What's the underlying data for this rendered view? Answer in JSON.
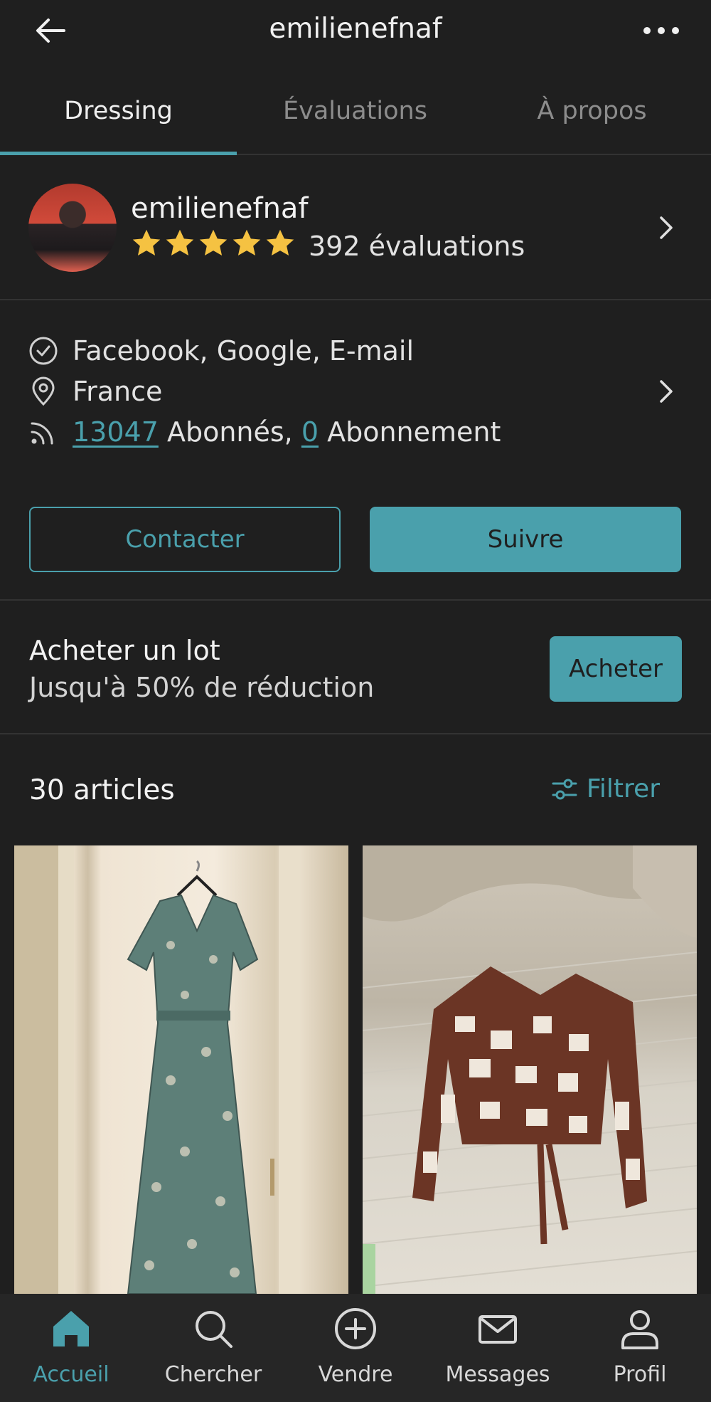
{
  "header": {
    "title": "emilienefnaf",
    "back_icon": "arrow-left-icon",
    "more_icon": "more-dots-icon"
  },
  "tabs": [
    {
      "label": "Dressing",
      "active": true
    },
    {
      "label": "Évaluations",
      "active": false
    },
    {
      "label": "À propos",
      "active": false
    }
  ],
  "profile": {
    "username": "emilienefnaf",
    "rating_stars": 5,
    "reviews": "392 évaluations"
  },
  "info": {
    "verified": "Facebook, Google, E-mail",
    "location": "France",
    "followers_count": "13047",
    "followers_label": " Abonnés, ",
    "following_count": "0",
    "following_label": " Abonnement"
  },
  "actions": {
    "contact": "Contacter",
    "follow": "Suivre"
  },
  "bundle": {
    "title": "Acheter un lot",
    "subtitle": "Jusqu'à 50% de réduction",
    "button": "Acheter"
  },
  "items": {
    "count": "30 articles",
    "filter": "Filtrer"
  },
  "nav": [
    {
      "label": "Accueil",
      "icon": "home-icon",
      "active": true
    },
    {
      "label": "Chercher",
      "icon": "search-icon",
      "active": false
    },
    {
      "label": "Vendre",
      "icon": "plus-circle-icon",
      "active": false
    },
    {
      "label": "Messages",
      "icon": "mail-icon",
      "active": false
    },
    {
      "label": "Profil",
      "icon": "user-icon",
      "active": false
    }
  ],
  "colors": {
    "accent": "#4aa0ac",
    "background": "#1f1f1f",
    "star": "#f5c242"
  }
}
